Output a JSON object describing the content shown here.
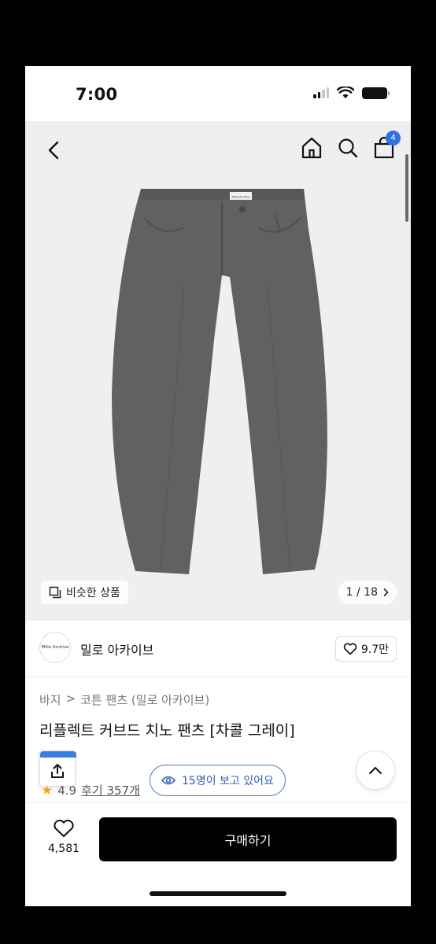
{
  "status_bar": {
    "time": "7:00"
  },
  "nav": {
    "cart_count": "4"
  },
  "hero": {
    "brand_tag": "Millo Archive",
    "similar_label": "비슷한 상품",
    "image_counter": "1 / 18"
  },
  "brand": {
    "logo_text": "Millo Archive",
    "name": "밀로 아카이브",
    "likes": "9.7만"
  },
  "breadcrumb": [
    "바지",
    "코튼 팬츠 (밀로 아카이브)"
  ],
  "breadcrumb_sep": ">",
  "product": {
    "title": "리플렉트 커브드 치노 팬츠 [차콜 그레이]",
    "rating": "4.9",
    "reviews": "후기 357개",
    "viewers": "15명이 보고 있어요"
  },
  "bottom": {
    "wish_count": "4,581",
    "buy_label": "구매하기"
  },
  "colors": {
    "accent_blue": "#2f6fe8",
    "pants": "#5f625f",
    "buy_button": "#000000",
    "star": "#f3a51a"
  },
  "icons": [
    "back-icon",
    "home-icon",
    "search-icon",
    "cart-icon",
    "similar-icon",
    "chevron-right-icon",
    "heart-icon",
    "share-icon",
    "eye-icon",
    "chevron-up-icon",
    "star-icon",
    "signal-icon",
    "wifi-icon",
    "battery-icon"
  ]
}
